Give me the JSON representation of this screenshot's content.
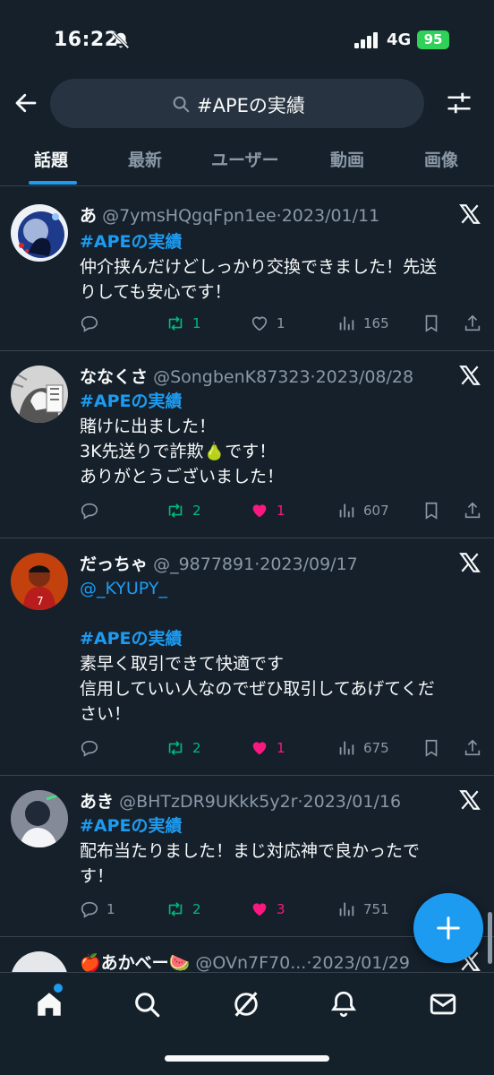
{
  "status_bar": {
    "time": "16:22",
    "network": "4G",
    "battery": "95"
  },
  "search": {
    "query": "#APEの実績"
  },
  "tabs": [
    {
      "label": "話題",
      "active": true
    },
    {
      "label": "最新"
    },
    {
      "label": "ユーザー"
    },
    {
      "label": "動画"
    },
    {
      "label": "画像"
    }
  ],
  "posts": [
    {
      "name": "あ",
      "handle": "@7ymsHQgqFpn1ee",
      "date": "2023/01/11",
      "lines": [
        "#APEの実績",
        "仲介挟んだけどしっかり交換できました！先送",
        "りしても安心です！"
      ],
      "replies": "",
      "retweets": "1",
      "likes": "1",
      "liked": false,
      "views": "165"
    },
    {
      "name": "ななくさ",
      "handle": "@SongbenK87323",
      "date": "2023/08/28",
      "lines": [
        "#APEの実績",
        "賭けに出ました！",
        "3K先送りで詐欺🍐です！",
        "ありがとうございました！"
      ],
      "replies": "",
      "retweets": "2",
      "likes": "1",
      "liked": true,
      "views": "607"
    },
    {
      "name": "だっちゃ",
      "handle": "@_9877891",
      "date": "2023/09/17",
      "lines": [
        "@_KYUPY_",
        "",
        "#APEの実績",
        "素早く取引できて快適です",
        "信用していい人なのでぜひ取引してあげてくだ",
        "さい！"
      ],
      "replies": "",
      "retweets": "2",
      "likes": "1",
      "liked": true,
      "views": "675"
    },
    {
      "name": "あき",
      "handle": "@BHTzDR9UKkk5y2r",
      "date": "2023/01/16",
      "lines": [
        "#APEの実績",
        "配布当たりました！まじ対応神で良かったで",
        "す！"
      ],
      "replies": "1",
      "retweets": "2",
      "likes": "3",
      "liked": true,
      "views": "751"
    },
    {
      "name": "🍎あかべー🍉",
      "handle": "@OVn7F70...",
      "date": "2023/01/29"
    }
  ],
  "colors": {
    "accent": "#1d9bf0",
    "retweet": "#00ba7c",
    "like": "#f91880",
    "background": "#15202b",
    "muted": "#8b98a5"
  },
  "icons": [
    "back-arrow-icon",
    "search-icon",
    "filter-icon",
    "x-logo-icon",
    "reply-icon",
    "retweet-icon",
    "heart-icon",
    "views-icon",
    "bookmark-icon",
    "share-icon",
    "compose-icon",
    "home-icon",
    "explore-icon",
    "grok-icon",
    "notifications-icon",
    "messages-icon"
  ]
}
